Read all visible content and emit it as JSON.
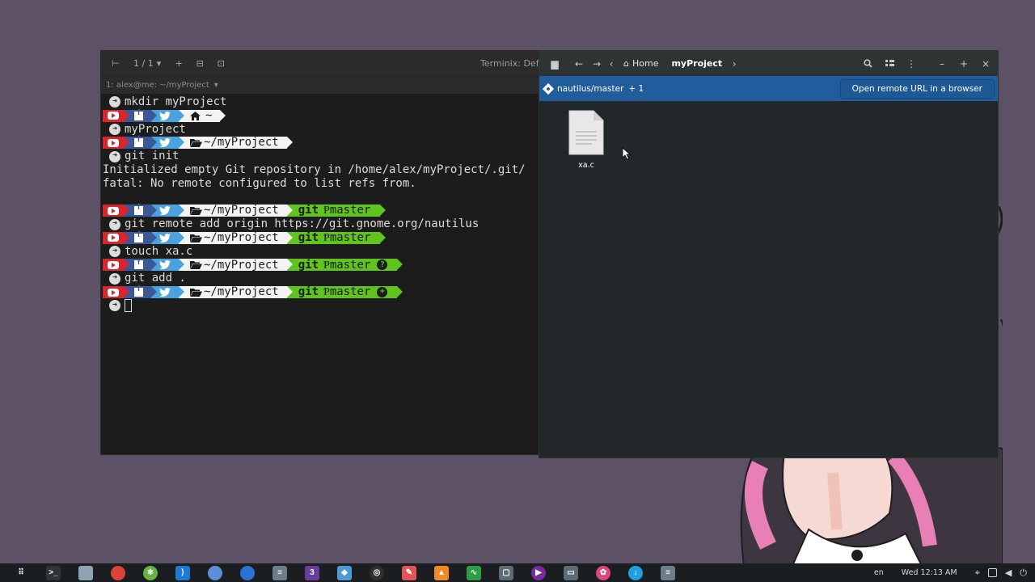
{
  "terminal": {
    "tab_counter": "1 / 1",
    "title": "Terminix: Defa",
    "session_label": "1: alex@me: ~/myProject",
    "lines": [
      {
        "kind": "cmd",
        "text": "mkdir myProject"
      },
      {
        "kind": "prompt",
        "path": "~",
        "path_icon": "home-icon"
      },
      {
        "kind": "cmd",
        "text": "myProject"
      },
      {
        "kind": "prompt",
        "path": "~/myProject",
        "path_icon": "folder-open-icon"
      },
      {
        "kind": "cmd",
        "text": "git init"
      },
      {
        "kind": "out",
        "text": "Initialized empty Git repository in /home/alex/myProject/.git/"
      },
      {
        "kind": "out",
        "text": "fatal: No remote configured to list refs from."
      },
      {
        "kind": "blank",
        "text": ""
      },
      {
        "kind": "prompt",
        "path": "~/myProject",
        "path_icon": "folder-open-icon",
        "git": "master"
      },
      {
        "kind": "cmd",
        "text": "git remote add origin https://git.gnome.org/nautilus"
      },
      {
        "kind": "prompt",
        "path": "~/myProject",
        "path_icon": "folder-open-icon",
        "git": "master"
      },
      {
        "kind": "cmd",
        "text": "touch xa.c"
      },
      {
        "kind": "prompt",
        "path": "~/myProject",
        "path_icon": "folder-open-icon",
        "git": "master",
        "badge": "?"
      },
      {
        "kind": "cmd",
        "text": "git add ."
      },
      {
        "kind": "prompt",
        "path": "~/myProject",
        "path_icon": "folder-open-icon",
        "git": "master",
        "badge": "+"
      },
      {
        "kind": "cursor",
        "text": ""
      }
    ],
    "git_word": "git",
    "branch_glyph": "Ᵽ"
  },
  "files": {
    "breadcrumb_home": "Home",
    "breadcrumb_current": "myProject",
    "infobar": {
      "branch": "nautilus/master",
      "changes": "+ 1",
      "button_label": "Open remote URL in a browser"
    },
    "items": [
      {
        "name": "xa.c"
      }
    ]
  },
  "taskbar": {
    "apps": [
      {
        "name": "app-grid-icon",
        "color": "#1b1e20",
        "glyph": "⠿"
      },
      {
        "name": "terminal-icon",
        "color": "#2e3436",
        "glyph": ">_"
      },
      {
        "name": "files-icon",
        "color": "#8fa4b3",
        "glyph": ""
      },
      {
        "name": "chrome-icon",
        "color": "#db4437",
        "glyph": ""
      },
      {
        "name": "atom-icon",
        "color": "#66b246",
        "glyph": "⚛"
      },
      {
        "name": "vscode-icon",
        "color": "#1e7ad1",
        "glyph": "⟩"
      },
      {
        "name": "chromium-icon",
        "color": "#5b8fd6",
        "glyph": ""
      },
      {
        "name": "browser-icon",
        "color": "#2a72d6",
        "glyph": ""
      },
      {
        "name": "server-icon",
        "color": "#6c7e8a",
        "glyph": "≡"
      },
      {
        "name": "app3d-icon",
        "color": "#6a3d9a",
        "glyph": "3"
      },
      {
        "name": "drop-icon",
        "color": "#4a9ad4",
        "glyph": "◆"
      },
      {
        "name": "obs-icon",
        "color": "#303030",
        "glyph": "◎"
      },
      {
        "name": "text-editor-icon",
        "color": "#e05555",
        "glyph": "✎"
      },
      {
        "name": "vlc-icon",
        "color": "#f08a24",
        "glyph": "▲"
      },
      {
        "name": "monitor-icon",
        "color": "#2e9e44",
        "glyph": "∿"
      },
      {
        "name": "screenshot-icon",
        "color": "#5c6b74",
        "glyph": "▢"
      },
      {
        "name": "media-player-icon",
        "color": "#7a2a9c",
        "glyph": "▶"
      },
      {
        "name": "display-icon",
        "color": "#5c6b74",
        "glyph": "▭"
      },
      {
        "name": "flower-icon",
        "color": "#e0467a",
        "glyph": "✿"
      },
      {
        "name": "download-icon",
        "color": "#1fa0e0",
        "glyph": "↓"
      },
      {
        "name": "settings-panel-icon",
        "color": "#6c7e8a",
        "glyph": "≡"
      }
    ],
    "lang": "en",
    "clock": "Wed 12:13 AM"
  }
}
